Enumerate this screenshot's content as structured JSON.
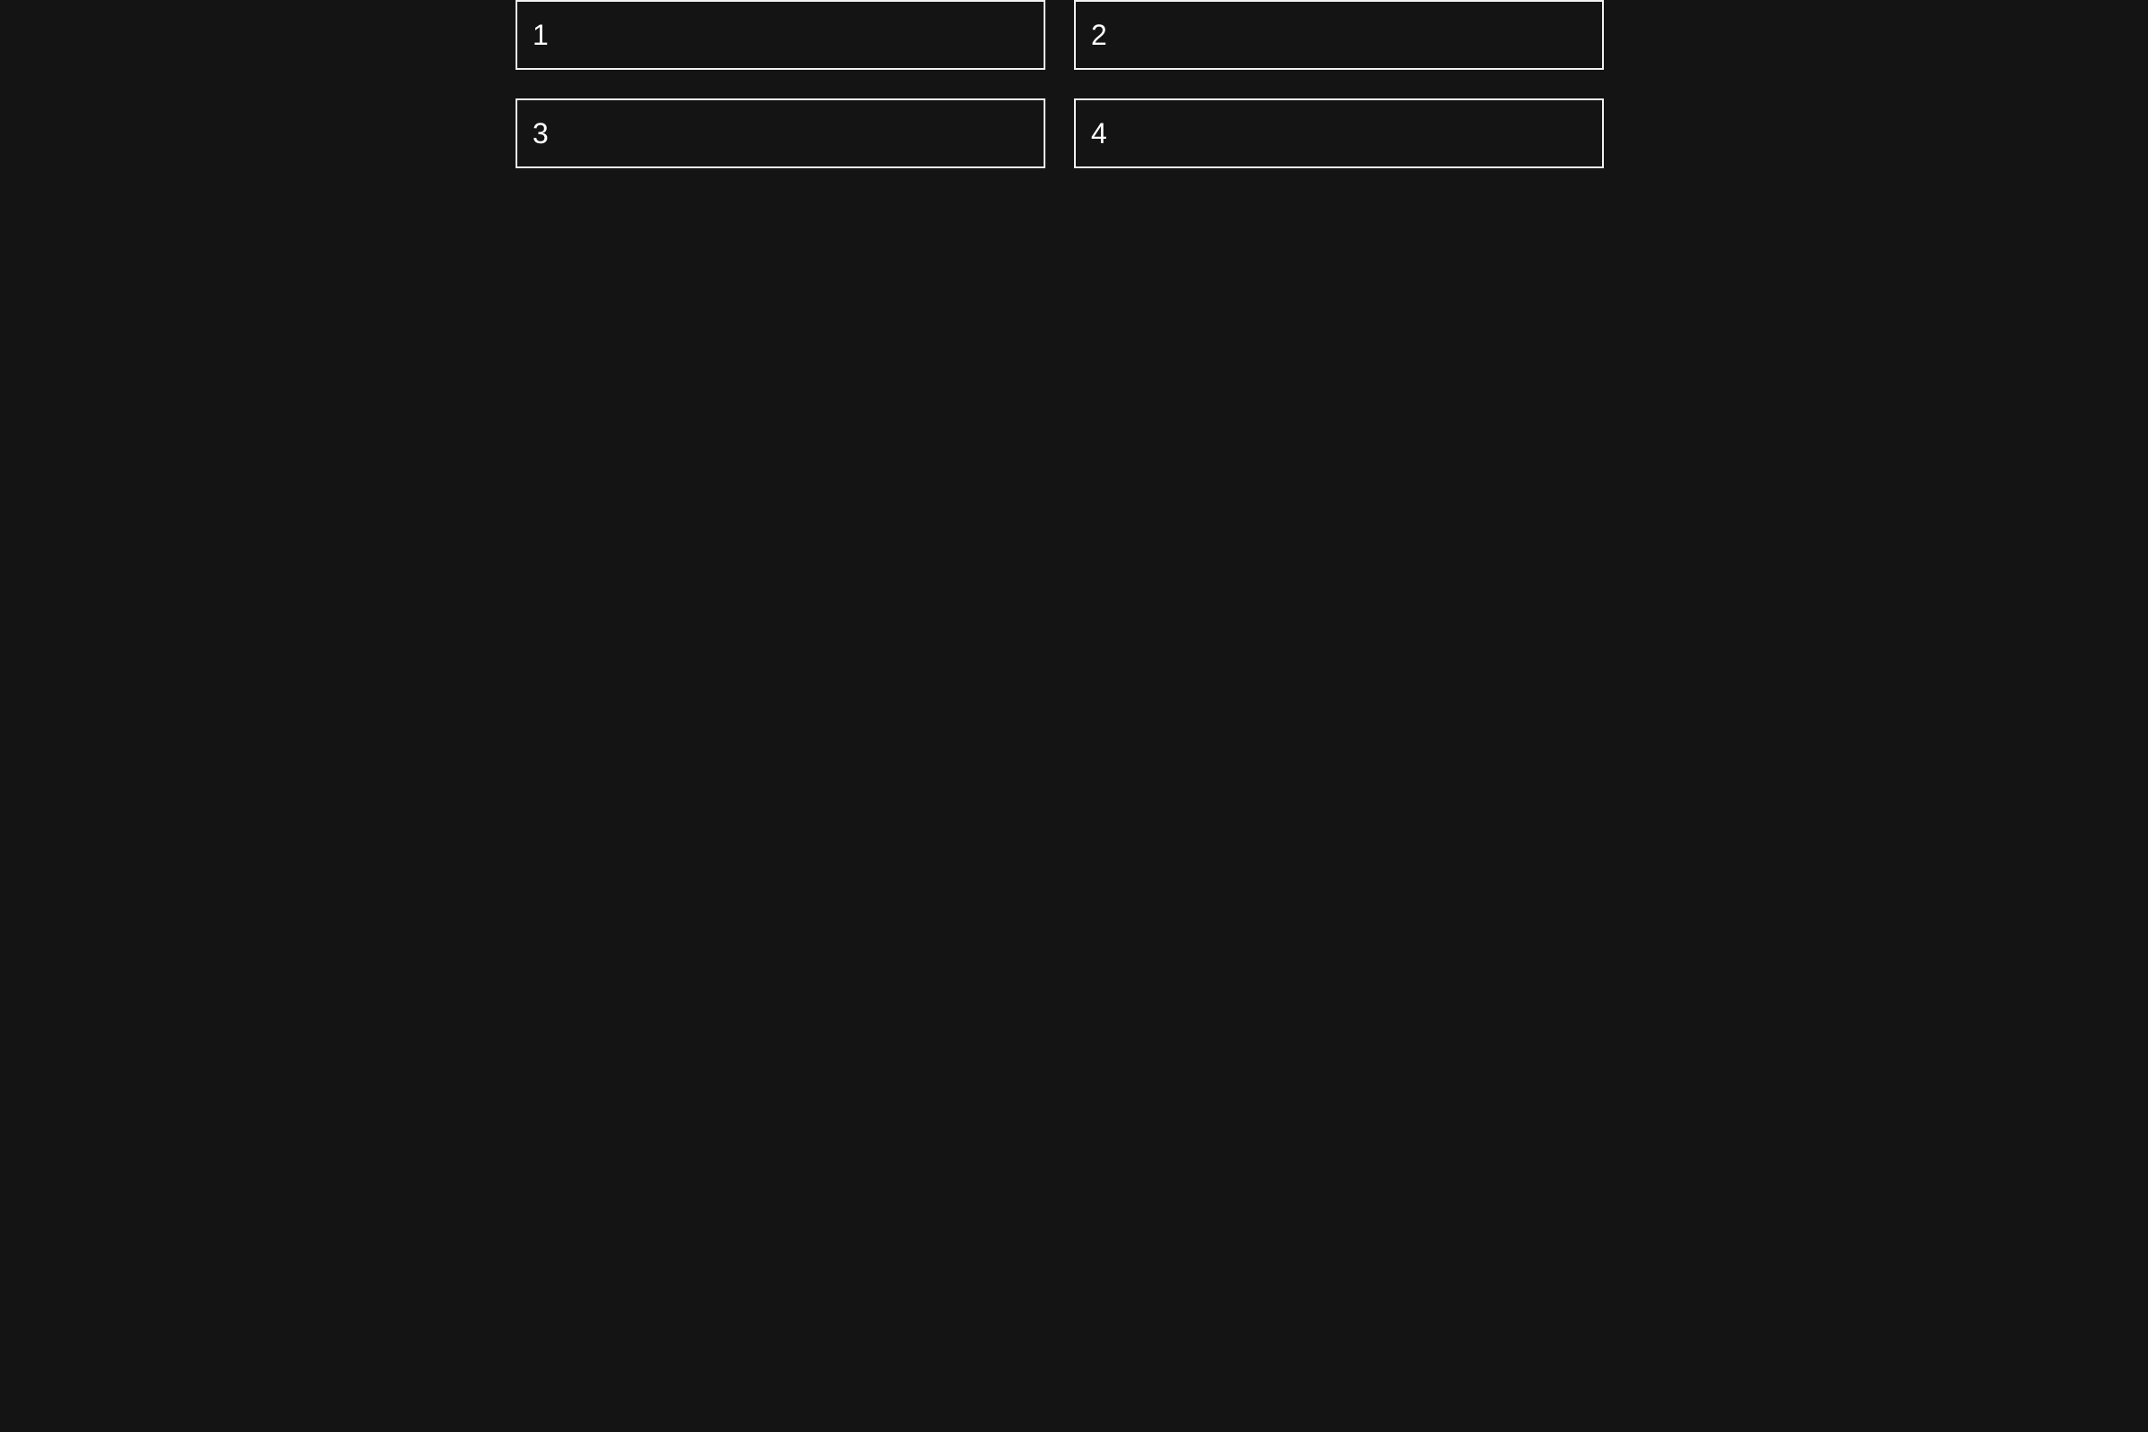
{
  "colors": {
    "background": "#141414",
    "tile_border": "#f2f2f2",
    "text": "#ffffff"
  },
  "tiles": [
    {
      "label": "1"
    },
    {
      "label": "2"
    },
    {
      "label": "3"
    },
    {
      "label": "4"
    }
  ]
}
